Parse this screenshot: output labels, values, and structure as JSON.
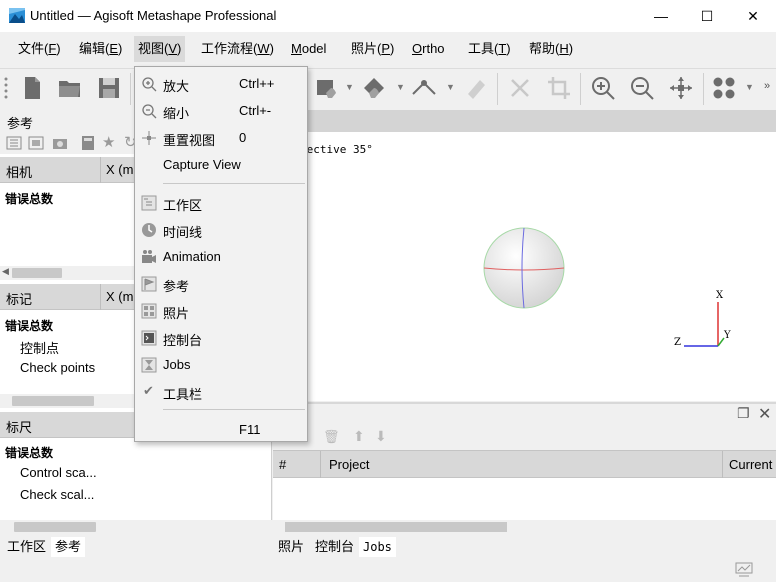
{
  "window": {
    "title": "Untitled — Agisoft Metashape Professional",
    "minimize": "—",
    "maximize": "☐",
    "close": "✕"
  },
  "menu": [
    {
      "label": "文件(",
      "key": "F",
      "tail": ")"
    },
    {
      "label": "编辑(",
      "key": "E",
      "tail": ")"
    },
    {
      "label": "视图(",
      "key": "V",
      "tail": ")"
    },
    {
      "label": "工作流程(",
      "key": "W",
      "tail": ")"
    },
    {
      "label": "",
      "key": "M",
      "tail": "odel"
    },
    {
      "label": "照片(",
      "key": "P",
      "tail": ")"
    },
    {
      "label": "",
      "key": "O",
      "tail": "rtho"
    },
    {
      "label": "工具(",
      "key": "T",
      "tail": ")"
    },
    {
      "label": "帮助(",
      "key": "H",
      "tail": ")"
    }
  ],
  "left_pane": {
    "reference_title": "参考",
    "camera_header": "相机",
    "x_header": "X (m",
    "camera_total": "错误总数",
    "marker_header": "标记",
    "marker_total": "错误总数",
    "control_points": "控制点",
    "check_points": "Check points",
    "scale_header": "标尺",
    "scale_total": "错误总数",
    "control_scale": "Control sca...",
    "check_scale": "Check scal..."
  },
  "viewport": {
    "caption": "pective 35°",
    "axis_x": "X",
    "axis_y": "Y",
    "axis_z": "Z"
  },
  "jobs": {
    "col_num": "#",
    "col_project": "Project",
    "col_current": "Current"
  },
  "bottom_tabs_left": [
    "工作区",
    "参考"
  ],
  "bottom_tabs_right": [
    "照片",
    "控制台",
    "Jobs"
  ],
  "view_menu": {
    "zoom_in": {
      "label": "放大",
      "shortcut": "Ctrl++"
    },
    "zoom_out": {
      "label": "缩小",
      "shortcut": "Ctrl+-"
    },
    "reset_view": {
      "label": "重置视图",
      "shortcut": "0"
    },
    "capture_view": {
      "label": "Capture View"
    },
    "workspace": {
      "label": "工作区"
    },
    "timeline": {
      "label": "时间线"
    },
    "animation": {
      "label": "Animation"
    },
    "reference": {
      "label": "参考"
    },
    "photos": {
      "label": "照片"
    },
    "console": {
      "label": "控制台"
    },
    "jobs": {
      "label": "Jobs"
    },
    "toolbar": {
      "label": "工具栏"
    },
    "fullscreen": {
      "shortcut": "F11"
    }
  },
  "colors": {
    "accent_blue": "#1f5fbf",
    "menu_highlight": "#dadada",
    "header_gray": "#d8d8d8"
  }
}
